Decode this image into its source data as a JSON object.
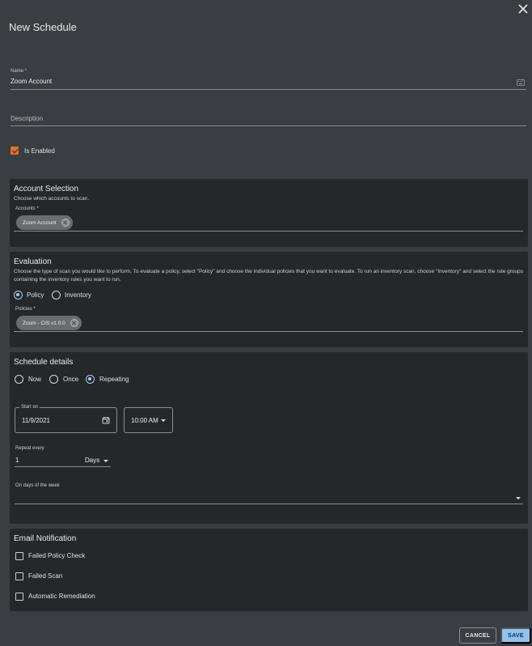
{
  "dialog": {
    "title": "New Schedule"
  },
  "name_field": {
    "label": "Name *",
    "value": "Zoom Account"
  },
  "description_field": {
    "placeholder": "Description"
  },
  "is_enabled": {
    "label": "Is Enabled",
    "checked": true
  },
  "account_selection": {
    "title": "Account Selection",
    "subtitle": "Choose which accounts to scan.",
    "accounts_label": "Accounts *",
    "chips": [
      "Zoom Account"
    ]
  },
  "evaluation": {
    "title": "Evaluation",
    "description": "Choose the type of scan you would like to perform. To evaluate a policy, select \"Policy\" and choose the individual policies that you want to evaluate. To run an inventory scan, choose \"Inventory\" and select the rule groups containing the inventory rules you want to run.",
    "options": [
      "Policy",
      "Inventory"
    ],
    "selected": "Policy",
    "policies_label": "Policies *",
    "chips": [
      "Zoom - CIS v1.0.0"
    ]
  },
  "schedule_details": {
    "title": "Schedule details",
    "options": [
      "Now",
      "Once",
      "Repeating"
    ],
    "selected": "Repeating",
    "start_on_label": "Start on",
    "start_date": "11/9/2021",
    "start_time": "10:00 AM",
    "repeat_every_label": "Repeat every",
    "repeat_value": "1",
    "repeat_unit": "Days",
    "days_of_week_label": "On days of the week"
  },
  "email_notification": {
    "title": "Email Notification",
    "items": [
      "Failed Policy Check",
      "Failed Scan",
      "Automatic Remediation"
    ]
  },
  "footer": {
    "cancel_label": "CANCEL",
    "save_label": "SAVE"
  },
  "colors": {
    "accent_orange": "#e36f2c",
    "accent_blue": "#8fc3f2",
    "background": "#3a3d42",
    "panel": "#25272b"
  }
}
